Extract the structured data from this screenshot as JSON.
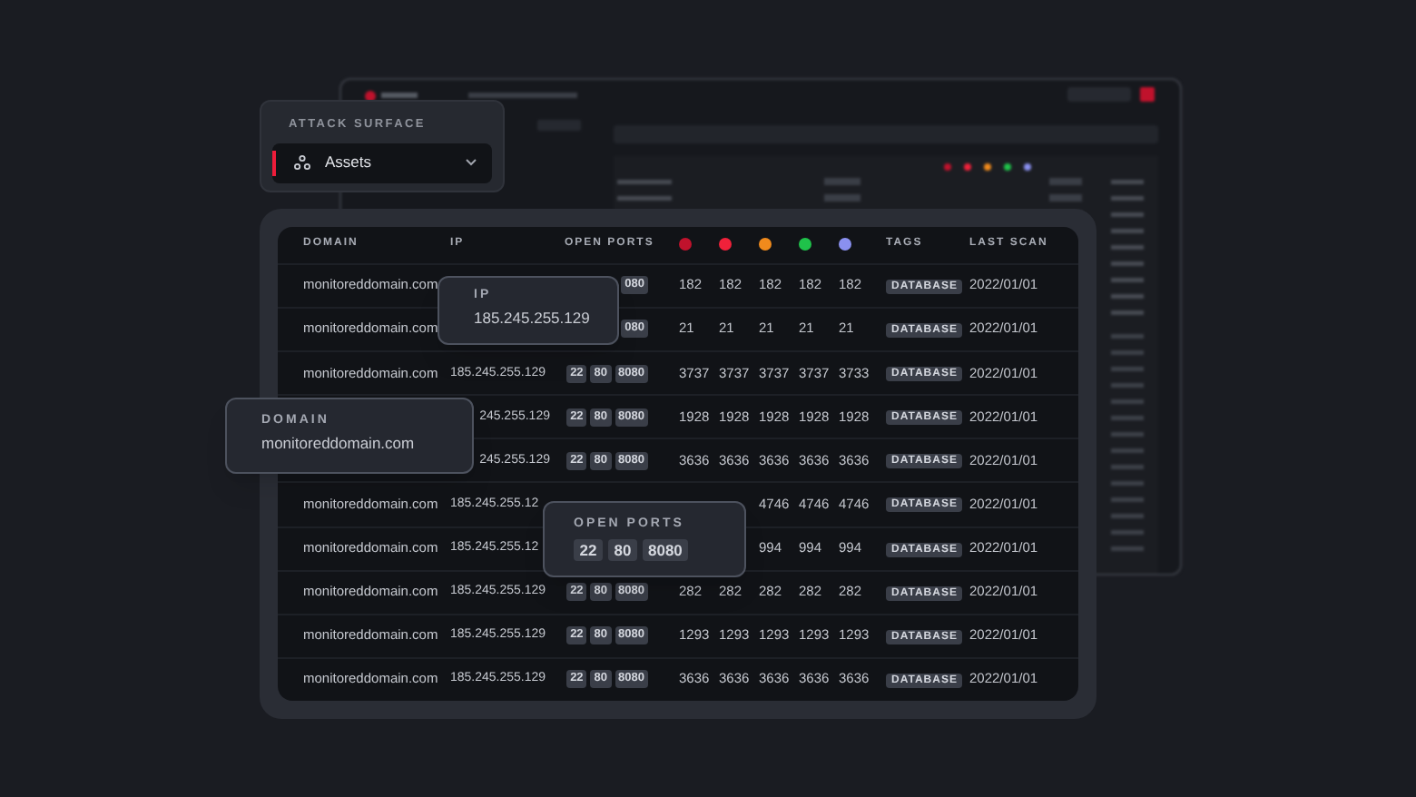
{
  "sidebar_card": {
    "section_label": "ATTACK SURFACE",
    "item": {
      "label": "Assets",
      "selected": true
    }
  },
  "table": {
    "columns": [
      {
        "kind": "text",
        "label": "DOMAIN"
      },
      {
        "kind": "text",
        "label": "IP"
      },
      {
        "kind": "text",
        "label": "OPEN PORTS"
      },
      {
        "kind": "severity",
        "color": "#c0122c"
      },
      {
        "kind": "severity",
        "color": "#f0213a"
      },
      {
        "kind": "severity",
        "color": "#f08a1c"
      },
      {
        "kind": "severity",
        "color": "#1fc24a"
      },
      {
        "kind": "severity",
        "color": "#8a90f0"
      },
      {
        "kind": "text",
        "label": "TAGS"
      },
      {
        "kind": "text",
        "label": "LAST SCAN"
      }
    ],
    "rows": [
      {
        "kind": "plain",
        "domain": "monitoreddomain.com",
        "ports": [
          "080"
        ],
        "counts": [
          "182",
          "182",
          "182",
          "182",
          "182"
        ],
        "tag": "DATABASE",
        "last_scan": "2022/01/01"
      },
      {
        "kind": "plain",
        "domain": "monitoreddomain.com",
        "ports": [
          "080"
        ],
        "counts": [
          "21",
          "21",
          "21",
          "21",
          "21"
        ],
        "tag": "DATABASE",
        "last_scan": "2022/01/01"
      },
      {
        "kind": "plain",
        "domain": "monitoreddomain.com",
        "ip": "185.245.255.129",
        "ports": [
          "22",
          "80",
          "8080"
        ],
        "counts": [
          "3737",
          "3737",
          "3737",
          "3737",
          "3733"
        ],
        "tag": "DATABASE",
        "last_scan": "2022/01/01"
      },
      {
        "kind": "clipped",
        "ip": "245.255.129",
        "ports": [
          "22",
          "80",
          "8080"
        ],
        "counts": [
          "1928",
          "1928",
          "1928",
          "1928",
          "1928"
        ],
        "tag": "DATABASE",
        "last_scan": "2022/01/01"
      },
      {
        "kind": "clipped",
        "ip": "245.255.129",
        "ports": [
          "22",
          "80",
          "8080"
        ],
        "counts": [
          "3636",
          "3636",
          "3636",
          "3636",
          "3636"
        ],
        "tag": "DATABASE",
        "last_scan": "2022/01/01"
      },
      {
        "kind": "plain",
        "domain": "monitoreddomain.com",
        "ip": "185.245.255.12",
        "counts": [
          "4746",
          "4746",
          "4746"
        ],
        "tag": "DATABASE",
        "last_scan": "2022/01/01"
      },
      {
        "kind": "plain",
        "domain": "monitoreddomain.com",
        "ip": "185.245.255.12",
        "counts": [
          "994",
          "994",
          "994"
        ],
        "tag": "DATABASE",
        "last_scan": "2022/01/01"
      },
      {
        "kind": "plain",
        "domain": "monitoreddomain.com",
        "ip": "185.245.255.129",
        "ports": [
          "22",
          "80",
          "8080"
        ],
        "counts": [
          "282",
          "282",
          "282",
          "282",
          "282"
        ],
        "tag": "DATABASE",
        "last_scan": "2022/01/01"
      },
      {
        "kind": "plain",
        "domain": "monitoreddomain.com",
        "ip": "185.245.255.129",
        "ports": [
          "22",
          "80",
          "8080"
        ],
        "counts": [
          "1293",
          "1293",
          "1293",
          "1293",
          "1293"
        ],
        "tag": "DATABASE",
        "last_scan": "2022/01/01"
      },
      {
        "kind": "plain",
        "domain": "monitoreddomain.com",
        "ip": "185.245.255.129",
        "ports": [
          "22",
          "80",
          "8080"
        ],
        "counts": [
          "3636",
          "3636",
          "3636",
          "3636",
          "3636"
        ],
        "tag": "DATABASE",
        "last_scan": "2022/01/01"
      }
    ]
  },
  "tooltips": [
    {
      "kind": "ip",
      "label": "IP",
      "value": "185.245.255.129"
    },
    {
      "kind": "domain",
      "label": "DOMAIN",
      "value": "monitoreddomain.com"
    },
    {
      "kind": "ports",
      "label": "OPEN PORTS",
      "ports": [
        "22",
        "80",
        "8080"
      ]
    }
  ]
}
